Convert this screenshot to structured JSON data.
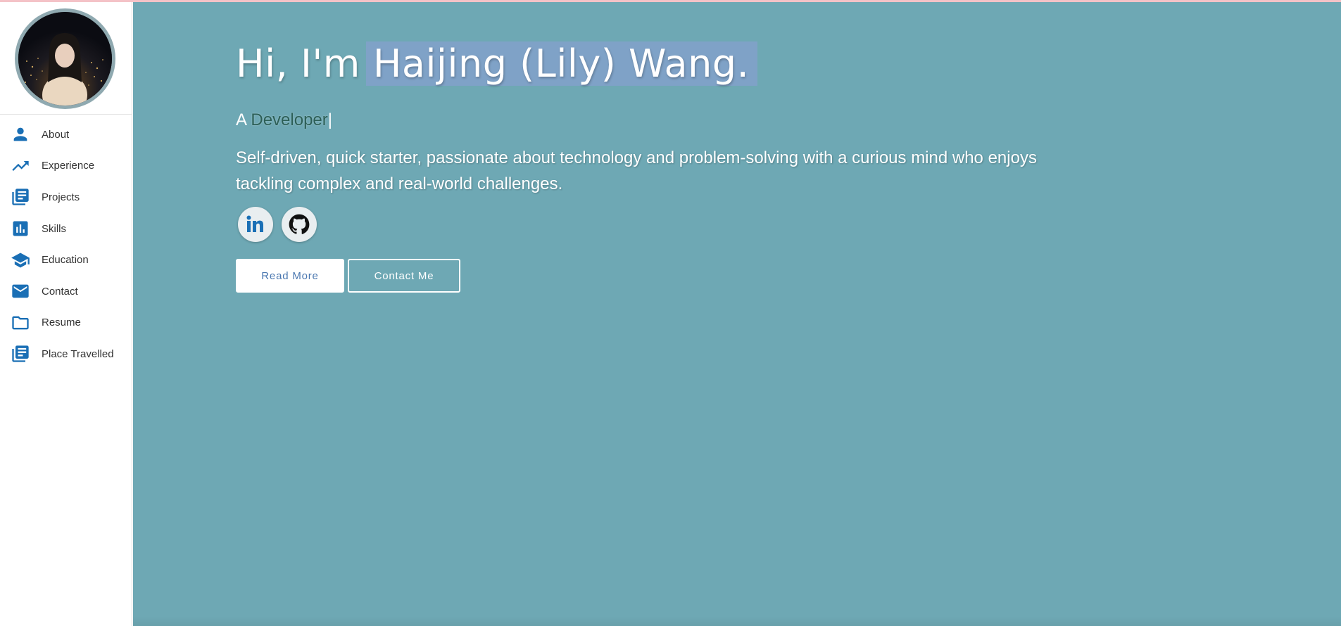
{
  "colors": {
    "accent": "#1a6fb5",
    "main_background": "#6ea8b4",
    "name_highlight": "#7fa2c7",
    "typed_text": "#2c5f57"
  },
  "sidebar": {
    "avatar_alt": "Profile photo",
    "items": [
      {
        "label": "About",
        "icon": "person-icon"
      },
      {
        "label": "Experience",
        "icon": "trending-up-icon"
      },
      {
        "label": "Projects",
        "icon": "library-books-icon"
      },
      {
        "label": "Skills",
        "icon": "bar-chart-icon"
      },
      {
        "label": "Education",
        "icon": "school-icon"
      },
      {
        "label": "Contact",
        "icon": "mail-icon"
      },
      {
        "label": "Resume",
        "icon": "folder-icon"
      },
      {
        "label": "Place Travelled",
        "icon": "library-books-icon"
      }
    ]
  },
  "hero": {
    "greeting": "Hi, I'm",
    "name": "Haijing (Lily) Wang.",
    "tagline_prefix": "A",
    "tagline_typed": "Developer",
    "cursor": "|",
    "description": "Self-driven, quick starter, passionate about technology and problem-solving with a curious mind who enjoys tackling complex and real-world challenges.",
    "socials": [
      {
        "name": "LinkedIn",
        "icon": "linkedin-icon"
      },
      {
        "name": "GitHub",
        "icon": "github-icon"
      }
    ],
    "buttons": {
      "read_more": "Read More",
      "contact_me": "Contact Me"
    }
  }
}
